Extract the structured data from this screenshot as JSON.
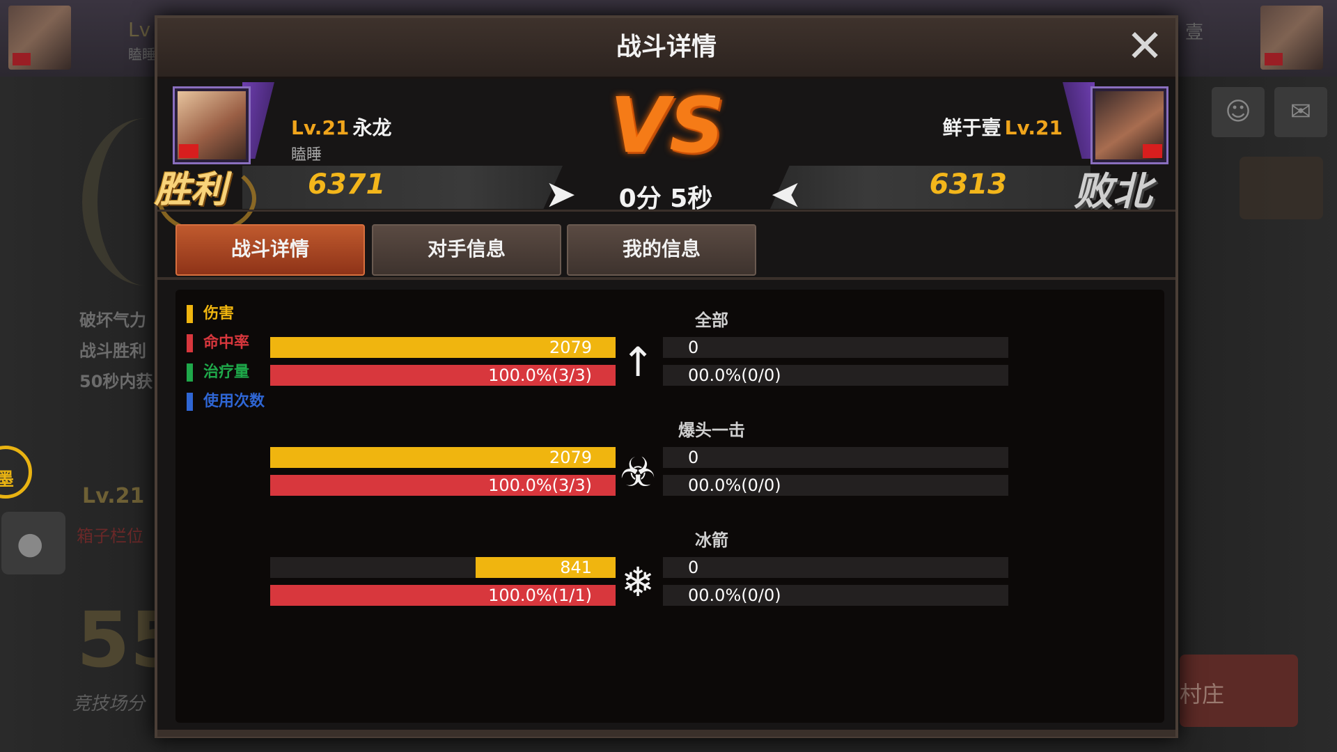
{
  "background": {
    "left_lv": "Lv",
    "left_sub": "瞌睡",
    "right_name": "壹",
    "tasks": [
      "破坏气力",
      "战斗胜利",
      "50秒内获"
    ],
    "lv21": "Lv.21",
    "box_slot": "箱子栏位",
    "score": "55",
    "score_label": "竞技场分",
    "ring_text": "墨",
    "village": "村庄",
    "add_friend_icon": "add-friend-icon",
    "mail_icon": "mail-icon"
  },
  "modal": {
    "title": "战斗详情",
    "close_icon": "close-icon"
  },
  "players": {
    "left": {
      "level": "Lv.21",
      "name": "永龙",
      "guild": "瞌睡",
      "power": "6371",
      "result": "胜利"
    },
    "right": {
      "level": "Lv.21",
      "name": "鲜于壹",
      "power": "6313",
      "result": "败北"
    }
  },
  "battle": {
    "vs": "VS",
    "duration": "0分 5秒"
  },
  "tabs": [
    {
      "label": "战斗详情",
      "active": true
    },
    {
      "label": "对手信息",
      "active": false
    },
    {
      "label": "我的信息",
      "active": false
    }
  ],
  "legend": [
    {
      "label": "伤害",
      "color": "#f0b50f"
    },
    {
      "label": "命中率",
      "color": "#d8373d"
    },
    {
      "label": "治疗量",
      "color": "#1fa84a"
    },
    {
      "label": "使用次数",
      "color": "#2f66d4"
    }
  ],
  "skills": [
    {
      "name": "全部",
      "icon": "arrow-icon",
      "left_damage": "2079",
      "left_damage_fraction": 1.0,
      "left_hit": "100.0%(3/3)",
      "left_hit_fraction": 1.0,
      "right_damage": "0",
      "right_hit": "00.0%(0/0)"
    },
    {
      "name": "爆头一击",
      "icon": "helmet-icon",
      "left_damage": "2079",
      "left_damage_fraction": 1.0,
      "left_hit": "100.0%(3/3)",
      "left_hit_fraction": 1.0,
      "right_damage": "0",
      "right_hit": "00.0%(0/0)"
    },
    {
      "name": "冰箭",
      "icon": "snowflake-icon",
      "left_damage": "841",
      "left_damage_fraction": 0.405,
      "left_hit": "100.0%(1/1)",
      "left_hit_fraction": 1.0,
      "right_damage": "0",
      "right_hit": "00.0%(0/0)"
    }
  ],
  "colors": {
    "damage": "#f0b50f",
    "hit": "#d8373d",
    "accent_orange": "#f57b17",
    "power_gold": "#f3b61b",
    "level_orange": "#f0a51c"
  }
}
